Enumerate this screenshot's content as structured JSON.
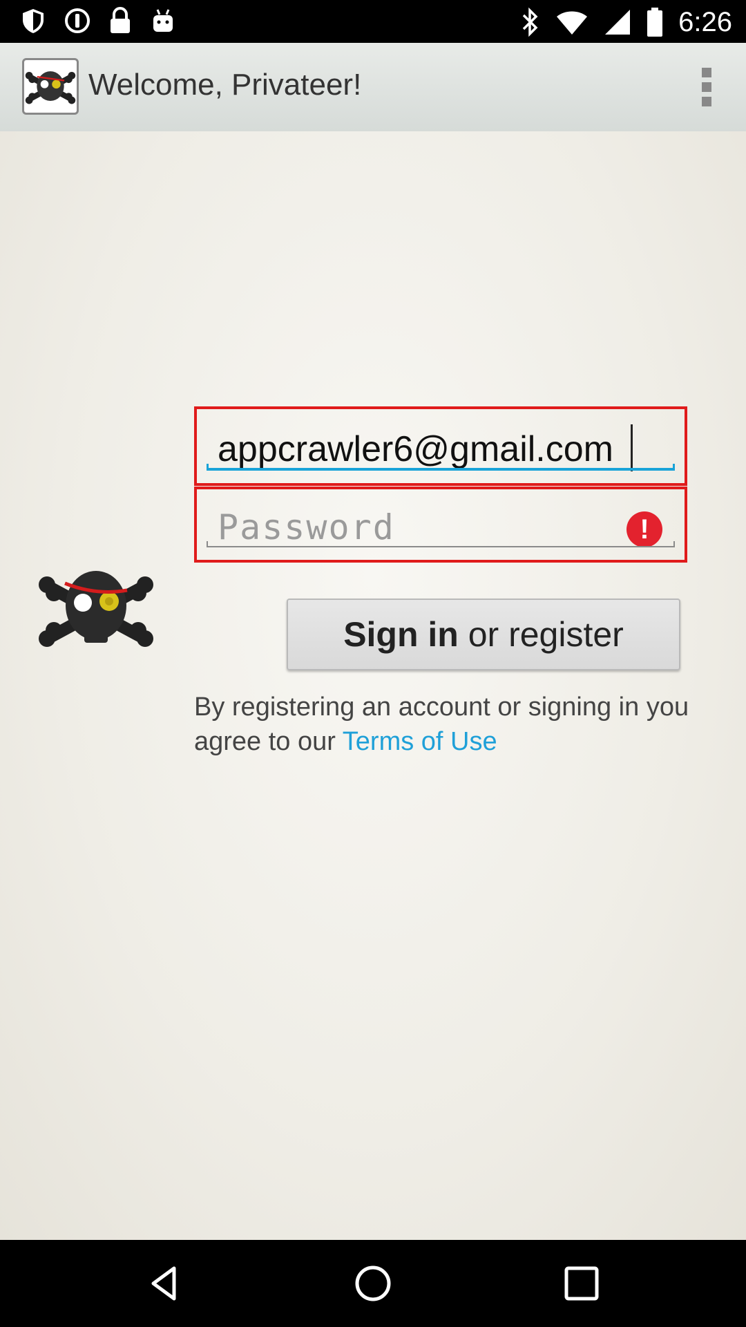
{
  "status_bar": {
    "time": "6:26",
    "left_icons": [
      "shield-icon",
      "info-circle-icon",
      "lock-icon",
      "android-icon"
    ],
    "right_icons": [
      "bluetooth-icon",
      "wifi-icon",
      "signal-icon",
      "battery-icon"
    ]
  },
  "action_bar": {
    "title": "Welcome, Privateer!",
    "app_icon": "skull-crossbones-icon",
    "overflow_icon": "more-vert-icon"
  },
  "login": {
    "logo_icon": "skull-crossbones-icon",
    "email_value": "appcrawler6@gmail.com",
    "password_placeholder": "Password",
    "password_error_icon": "error-icon",
    "error_mark": "!",
    "sign_in_bold": "Sign in",
    "sign_in_rest": " or register",
    "terms_prefix": "By registering an account or signing in you agree to our ",
    "terms_link": "Terms of Use"
  },
  "colors": {
    "error_border": "#e01b1b",
    "focus_underline": "#19a3d8",
    "link": "#1fa0d8",
    "error_icon": "#e3222e"
  },
  "nav_bar": {
    "buttons": [
      "back-icon",
      "home-icon",
      "recents-icon"
    ]
  }
}
